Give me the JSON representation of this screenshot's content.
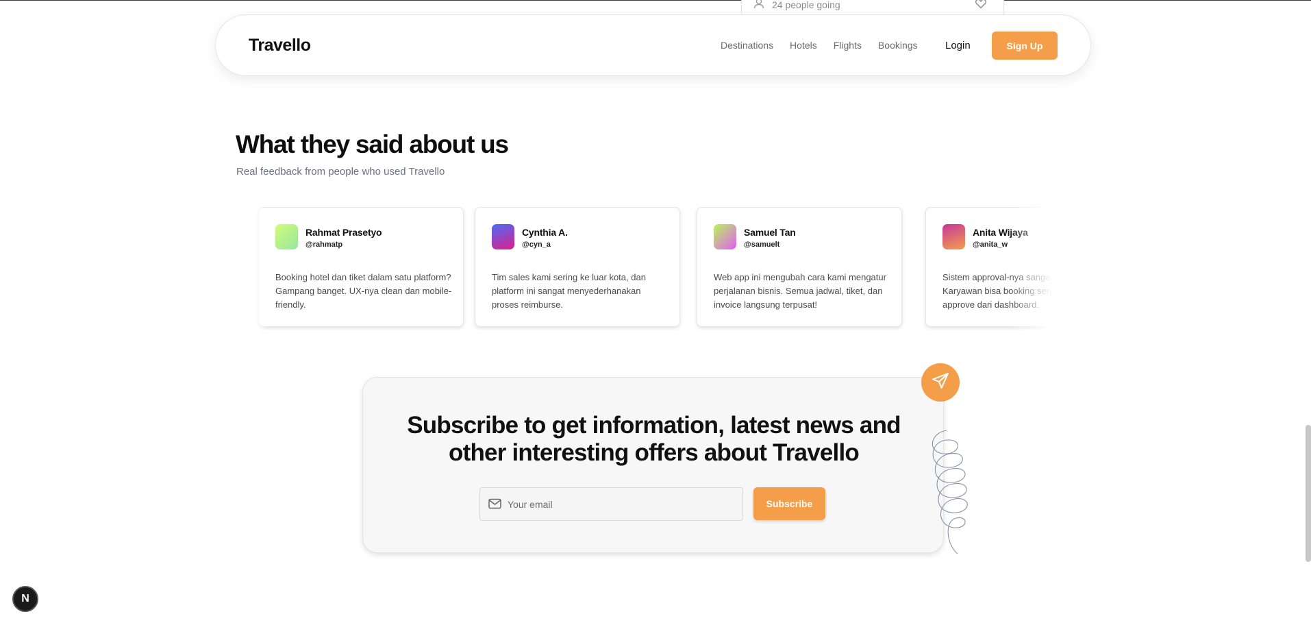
{
  "peek_card": {
    "text": "24 people going"
  },
  "navbar": {
    "brand": "Travello",
    "links": [
      "Destinations",
      "Hotels",
      "Flights",
      "Bookings"
    ],
    "login": "Login",
    "signup": "Sign Up"
  },
  "testimonials": {
    "title": "What they said about us",
    "subtitle": "Real feedback from people who used Travello",
    "cards": [
      {
        "name": "Rahmat Prasetyo",
        "handle": "@rahmatp",
        "text": "Booking hotel dan tiket dalam satu platform? Gampang banget. UX-nya clean dan mobile-friendly."
      },
      {
        "name": "Cynthia A.",
        "handle": "@cyn_a",
        "text": "Tim sales kami sering ke luar kota, dan platform ini sangat menyederhanakan proses reimburse."
      },
      {
        "name": "Samuel Tan",
        "handle": "@samuelt",
        "text": "Web app ini mengubah cara kami mengatur perjalanan bisnis. Semua jadwal, tiket, dan invoice langsung terpusat!"
      },
      {
        "name": "Anita Wijaya",
        "handle": "@anita_w",
        "text": "Sistem approval-nya sangat membantu. Karyawan bisa booking sendiri, saya tinggal approve dari dashboard."
      }
    ]
  },
  "subscribe": {
    "title_line1": "Subscribe to get information, latest news and",
    "title_line2": "other interesting offers about Travello",
    "email_placeholder": "Your email",
    "button": "Subscribe"
  },
  "dev_badge": {
    "label": "N"
  },
  "colors": {
    "accent": "#f59e4a",
    "avatar_gradients": [
      [
        "#d4fc79",
        "#96e6a1"
      ],
      [
        "#4a6cf7",
        "#e01e8a"
      ],
      [
        "#b6f75a",
        "#e35df5"
      ],
      [
        "#c4389b",
        "#f59e4a"
      ]
    ]
  }
}
